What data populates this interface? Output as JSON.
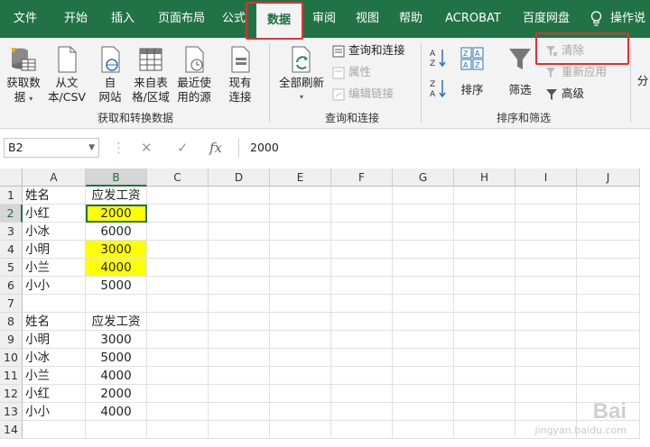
{
  "tabs": [
    {
      "label": "文件"
    },
    {
      "label": "开始"
    },
    {
      "label": "插入"
    },
    {
      "label": "页面布局"
    },
    {
      "label": "公式"
    },
    {
      "label": "数据",
      "active": true
    },
    {
      "label": "审阅"
    },
    {
      "label": "视图"
    },
    {
      "label": "帮助"
    },
    {
      "label": "ACROBAT"
    },
    {
      "label": "百度网盘"
    },
    {
      "label": "操作说"
    }
  ],
  "ribbon": {
    "get_data": {
      "l1": "获取数",
      "l2": "据"
    },
    "from_text": {
      "l1": "从文",
      "l2": "本/CSV"
    },
    "from_web": {
      "l1": "自",
      "l2": "网站"
    },
    "from_table": {
      "l1": "来自表",
      "l2": "格/区域"
    },
    "recent": {
      "l1": "最近使",
      "l2": "用的源"
    },
    "existing": {
      "l1": "现有",
      "l2": "连接"
    },
    "group1_label": "获取和转换数据",
    "refresh_all": {
      "l1": "全部刷新"
    },
    "queries_connections": "查询和连接",
    "properties": "属性",
    "edit_links": "编辑链接",
    "group2_label": "查询和连接",
    "sort_az": "A→Z",
    "sort_za": "Z→A",
    "sort": "排序",
    "filter": "筛选",
    "clear": "清除",
    "reapply": "重新应用",
    "advanced": "高级",
    "group3_label": "排序和筛选",
    "split": "分"
  },
  "formula_bar": {
    "name_box": "B2",
    "cancel_symbol": "✕",
    "enter_symbol": "✓",
    "fx_symbol": "fx",
    "value": "2000"
  },
  "columns": [
    "A",
    "B",
    "C",
    "D",
    "E",
    "F",
    "G",
    "H",
    "I",
    "J"
  ],
  "rows": [
    {
      "n": "1",
      "a": "姓名",
      "b": "应发工资",
      "hl": false
    },
    {
      "n": "2",
      "a": "小红",
      "b": "2000",
      "hl": true
    },
    {
      "n": "3",
      "a": "小冰",
      "b": "6000",
      "hl": false
    },
    {
      "n": "4",
      "a": "小明",
      "b": "3000",
      "hl": true
    },
    {
      "n": "5",
      "a": "小兰",
      "b": "4000",
      "hl": true
    },
    {
      "n": "6",
      "a": "小小",
      "b": "5000",
      "hl": false
    },
    {
      "n": "7",
      "a": "",
      "b": "",
      "hl": false
    },
    {
      "n": "8",
      "a": "姓名",
      "b": "应发工资",
      "hl": false
    },
    {
      "n": "9",
      "a": "小明",
      "b": "3000",
      "hl": false
    },
    {
      "n": "10",
      "a": "小冰",
      "b": "5000",
      "hl": false
    },
    {
      "n": "11",
      "a": "小兰",
      "b": "4000",
      "hl": false
    },
    {
      "n": "12",
      "a": "小红",
      "b": "2000",
      "hl": false
    },
    {
      "n": "13",
      "a": "小小",
      "b": "4000",
      "hl": false
    },
    {
      "n": "14",
      "a": "",
      "b": "",
      "hl": false
    }
  ],
  "colors": {
    "excel_green": "#217346",
    "highlight": "#ffff00",
    "annotation_red": "#e03030"
  },
  "watermark": {
    "big": "Bai",
    "small": "jingyan.baidu.com"
  }
}
